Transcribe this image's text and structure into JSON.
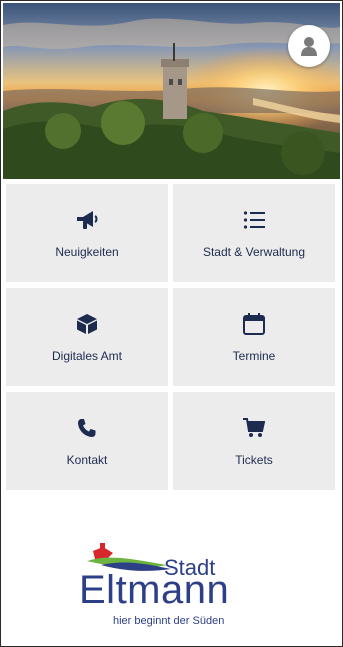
{
  "header": {
    "profile_icon": "user-silhouette-icon"
  },
  "tiles": [
    {
      "label": "Neuigkeiten",
      "icon": "megaphone-icon"
    },
    {
      "label": "Stadt & Verwaltung",
      "icon": "list-icon"
    },
    {
      "label": "Digitales Amt",
      "icon": "cube-icon"
    },
    {
      "label": "Termine",
      "icon": "calendar-icon"
    },
    {
      "label": "Kontakt",
      "icon": "phone-icon"
    },
    {
      "label": "Tickets",
      "icon": "cart-icon"
    }
  ],
  "logo": {
    "stadt": "Stadt",
    "name": "Eltmann",
    "tagline": "hier beginnt der Süden"
  },
  "colors": {
    "icon": "#1d2b4f",
    "tile_bg": "#ececec",
    "logo_blue": "#2d3f86",
    "logo_red": "#d7262c",
    "logo_green": "#6db33f"
  }
}
